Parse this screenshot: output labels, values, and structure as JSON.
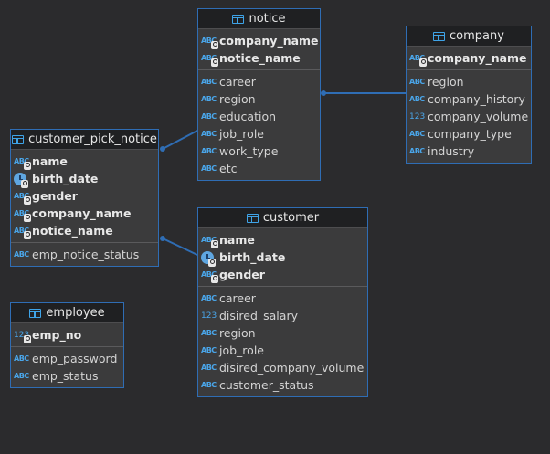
{
  "entities": {
    "notice": {
      "title": "notice",
      "keys": [
        {
          "name": "company_name",
          "type": "ABC"
        },
        {
          "name": "notice_name",
          "type": "ABC"
        }
      ],
      "columns": [
        {
          "name": "career",
          "type": "ABC"
        },
        {
          "name": "region",
          "type": "ABC"
        },
        {
          "name": "education",
          "type": "ABC"
        },
        {
          "name": "job_role",
          "type": "ABC"
        },
        {
          "name": "work_type",
          "type": "ABC"
        },
        {
          "name": "etc",
          "type": "ABC"
        }
      ]
    },
    "company": {
      "title": "company",
      "keys": [
        {
          "name": "company_name",
          "type": "ABC"
        }
      ],
      "columns": [
        {
          "name": "region",
          "type": "ABC"
        },
        {
          "name": "company_history",
          "type": "ABC"
        },
        {
          "name": "company_volume",
          "type": "123"
        },
        {
          "name": "company_type",
          "type": "ABC"
        },
        {
          "name": "industry",
          "type": "ABC"
        }
      ]
    },
    "customer_pick_notice": {
      "title": "customer_pick_notice",
      "keys": [
        {
          "name": "name",
          "type": "ABC"
        },
        {
          "name": "birth_date",
          "type": "date"
        },
        {
          "name": "gender",
          "type": "ABC"
        },
        {
          "name": "company_name",
          "type": "ABC"
        },
        {
          "name": "notice_name",
          "type": "ABC"
        }
      ],
      "columns": [
        {
          "name": "emp_notice_status",
          "type": "ABC"
        }
      ]
    },
    "customer": {
      "title": "customer",
      "keys": [
        {
          "name": "name",
          "type": "ABC"
        },
        {
          "name": "birth_date",
          "type": "date"
        },
        {
          "name": "gender",
          "type": "ABC"
        }
      ],
      "columns": [
        {
          "name": "career",
          "type": "ABC"
        },
        {
          "name": "disired_salary",
          "type": "123"
        },
        {
          "name": "region",
          "type": "ABC"
        },
        {
          "name": "job_role",
          "type": "ABC"
        },
        {
          "name": "disired_company_volume",
          "type": "ABC"
        },
        {
          "name": "customer_status",
          "type": "ABC"
        }
      ]
    },
    "employee": {
      "title": "employee",
      "keys": [
        {
          "name": "emp_no",
          "type": "123"
        }
      ],
      "columns": [
        {
          "name": "emp_password",
          "type": "ABC"
        },
        {
          "name": "emp_status",
          "type": "ABC"
        }
      ]
    }
  },
  "relationships": [
    {
      "from": "customer_pick_notice",
      "to": "notice"
    },
    {
      "from": "customer_pick_notice",
      "to": "customer"
    },
    {
      "from": "notice",
      "to": "company"
    }
  ],
  "colors": {
    "background": "#2b2b2d",
    "entity_border": "#2f6db4",
    "link": "#2f6db4",
    "type_icon": "#4aa6ea"
  }
}
